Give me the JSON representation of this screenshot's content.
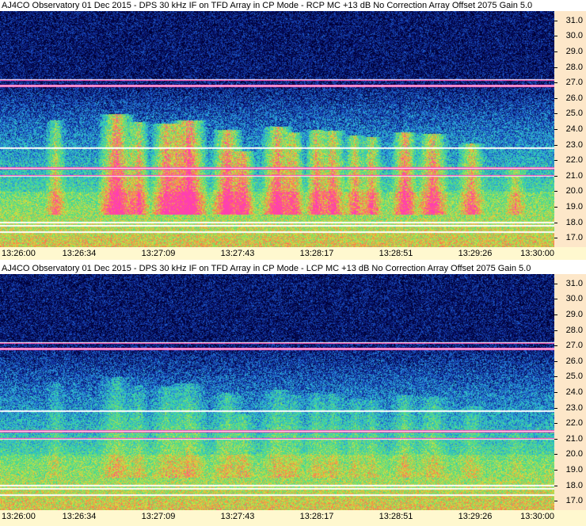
{
  "chart_data": [
    {
      "type": "heatmap",
      "title": "AJ4CO Observatory 01 Dec 2015 - DPS 30 kHz IF on TFD Array in CP Mode - RCP  MC +13 dB  No Correction Array  Offset 2075  Gain 5.0",
      "polarization": "RCP",
      "x_ticks": [
        "13:26:00",
        "13:26:34",
        "13:27:09",
        "13:27:43",
        "13:28:17",
        "13:28:51",
        "13:29:26",
        "13:30:00"
      ],
      "y_ticks": [
        "31.0",
        "30.0",
        "29.0",
        "28.0",
        "27.0",
        "26.0",
        "25.0",
        "24.0",
        "23.0",
        "22.0",
        "21.0",
        "20.0",
        "19.0",
        "18.0",
        "17.0"
      ],
      "ylim": [
        16.4,
        31.6
      ],
      "xlim": [
        "13:26:00",
        "13:30:00"
      ],
      "colormap": [
        "#000033",
        "#0a1a80",
        "#1f5fd0",
        "#2fb7d8",
        "#38d8a0",
        "#7fe060",
        "#d9e040",
        "#ff8040",
        "#ff3fb0"
      ]
    },
    {
      "type": "heatmap",
      "title": "AJ4CO Observatory 01 Dec 2015 - DPS 30 kHz IF on TFD Array in CP Mode - LCP  MC +13 dB  No Correction Array  Offset 2075  Gain 5.0",
      "polarization": "LCP",
      "x_ticks": [
        "13:26:00",
        "13:26:34",
        "13:27:09",
        "13:27:43",
        "13:28:17",
        "13:28:51",
        "13:29:26",
        "13:30:00"
      ],
      "y_ticks": [
        "31.0",
        "30.0",
        "29.0",
        "28.0",
        "27.0",
        "26.0",
        "25.0",
        "24.0",
        "23.0",
        "22.0",
        "21.0",
        "20.0",
        "19.0",
        "18.0",
        "17.0"
      ],
      "ylim": [
        16.4,
        31.6
      ],
      "xlim": [
        "13:26:00",
        "13:30:00"
      ],
      "colormap": [
        "#000033",
        "#0a1a80",
        "#1f5fd0",
        "#2fb7d8",
        "#38d8a0",
        "#7fe060",
        "#d9e040",
        "#ff8040",
        "#ff3fb0"
      ]
    }
  ]
}
